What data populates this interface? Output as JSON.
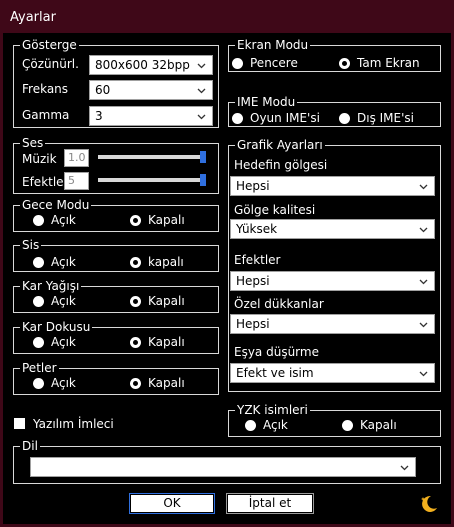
{
  "window": {
    "title": "Ayarlar"
  },
  "display": {
    "legend": "Gösterge",
    "resolution_label": "Çözünürl.",
    "resolution_value": "800x600 32bpp",
    "frequency_label": "Frekans",
    "frequency_value": "60",
    "gamma_label": "Gamma",
    "gamma_value": "3"
  },
  "sound": {
    "legend": "Ses",
    "music_label": "Müzik",
    "music_value": "1.0",
    "music_level": 1.0,
    "effects_label": "Efektler",
    "effects_value": "5",
    "effects_level": 1.0
  },
  "night_mode": {
    "legend": "Gece Modu",
    "on": "Açık",
    "off": "Kapalı",
    "selected": "off"
  },
  "fog": {
    "legend": "Sis",
    "on": "Açık",
    "off": "kapalı",
    "selected": "off"
  },
  "snowfall": {
    "legend": "Kar Yağışı",
    "on": "Açık",
    "off": "Kapalı",
    "selected": "off"
  },
  "snow_texture": {
    "legend": "Kar Dokusu",
    "on": "Açık",
    "off": "Kapalı",
    "selected": "off"
  },
  "petals": {
    "legend": "Petler",
    "on": "Açık",
    "off": "Kapalı",
    "selected": "off"
  },
  "software_cursor": {
    "label": "Yazılım İmleci",
    "checked": false
  },
  "screen_mode": {
    "legend": "Ekran Modu",
    "window": "Pencere",
    "fullscreen": "Tam Ekran",
    "selected": "fullscreen"
  },
  "ime_mode": {
    "legend": "IME Modu",
    "game": "Oyun IME'si",
    "external": "Dış IME'si",
    "selected": "none"
  },
  "graphics": {
    "legend": "Grafik Ayarları",
    "target_shadow_label": "Hedefin gölgesi",
    "target_shadow_value": "Hepsi",
    "shadow_quality_label": "Gölge kalitesi",
    "shadow_quality_value": "Yüksek",
    "effects_label": "Efektler",
    "effects_value": "Hepsi",
    "private_shops_label": "Özel dükkanlar",
    "private_shops_value": "Hepsi",
    "item_drop_label": "Eşya düşürme",
    "item_drop_value": "Efekt ve isim"
  },
  "npc_names": {
    "legend": "YZK isimleri",
    "on": "Açık",
    "off": "Kapalı",
    "selected": "none"
  },
  "language": {
    "legend": "Dil",
    "value": ""
  },
  "buttons": {
    "ok": "OK",
    "cancel": "İptal et"
  },
  "icons": {
    "arrow": "chevron-down-icon",
    "theme": "moon-icon"
  },
  "colors": {
    "title_bar": "#3f0818",
    "slider_thumb": "#2f6fdf",
    "moon": "#f2b01e"
  }
}
